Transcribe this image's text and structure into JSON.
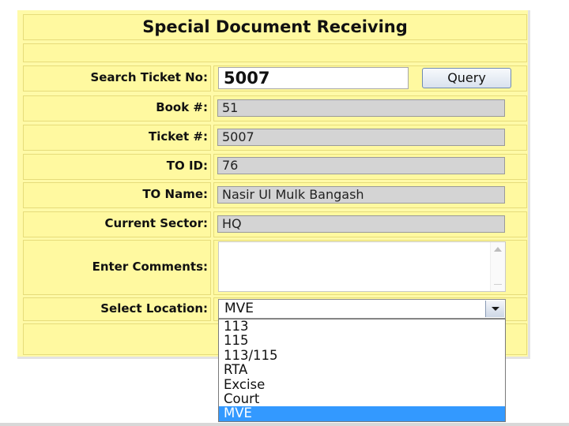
{
  "form": {
    "title": "Special Document Receiving",
    "search_label": "Search Ticket No:",
    "search_value": "5007",
    "query_button": "Query",
    "book_label": "Book #:",
    "book_value": "51",
    "ticket_label": "Ticket #:",
    "ticket_value": "5007",
    "to_id_label": "TO ID:",
    "to_id_value": "76",
    "to_name_label": "TO Name:",
    "to_name_value": "Nasir Ul Mulk Bangash",
    "sector_label": "Current Sector:",
    "sector_value": "HQ",
    "comments_label": "Enter Comments:",
    "comments_value": "",
    "location_label": "Select Location:",
    "location_value": "MVE",
    "location_options": [
      "113",
      "115",
      "113/115",
      "RTA",
      "Excise",
      "Court",
      "MVE"
    ]
  },
  "colors": {
    "panel": "#fffaa8",
    "selected_option": "#3399ff",
    "readonly_field": "#d4d4d4"
  }
}
